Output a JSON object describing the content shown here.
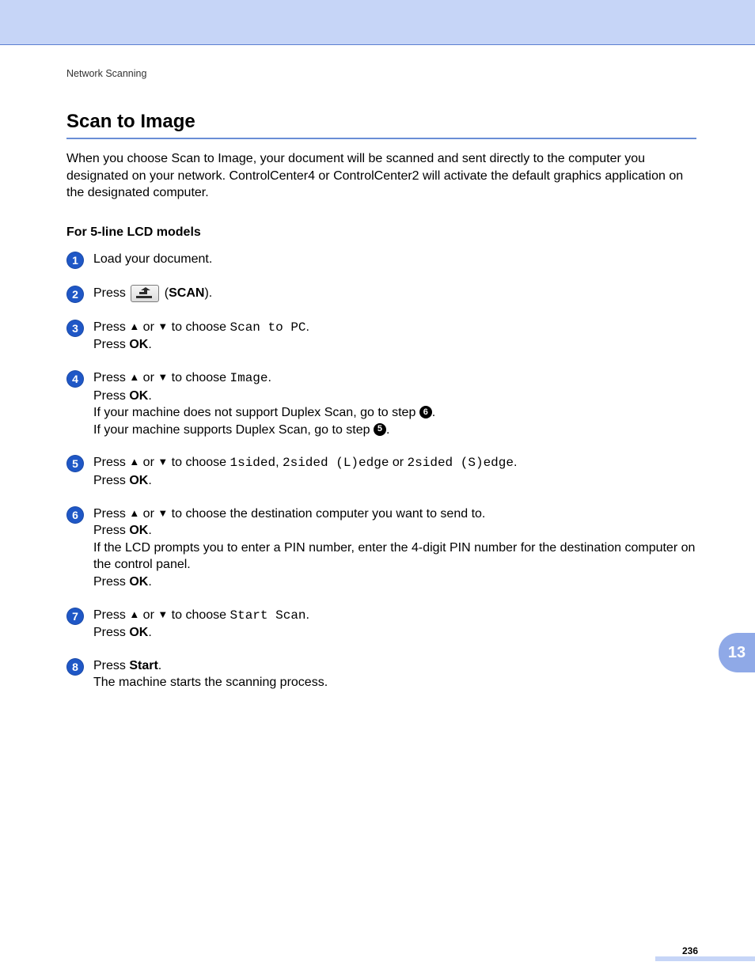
{
  "breadcrumb": "Network Scanning",
  "heading": "Scan to Image",
  "intro": "When you choose Scan to Image, your document will be scanned and sent directly to the computer you designated on your network. ControlCenter4 or ControlCenter2 will activate the default graphics application on the designated computer.",
  "subheading": "For 5-line LCD models",
  "ok_label": "OK",
  "chapter_tab": "13",
  "page_number": "236",
  "steps": {
    "s1": {
      "num": "1",
      "text": "Load your document."
    },
    "s2": {
      "num": "2",
      "press": "Press ",
      "scan_label": "SCAN",
      "close": ")."
    },
    "s3": {
      "num": "3",
      "press": "Press ",
      "or": " or ",
      "choose": " to choose ",
      "option": "Scan to PC",
      "press_ok": "Press "
    },
    "s4": {
      "num": "4",
      "press": "Press ",
      "or": " or ",
      "choose": " to choose ",
      "option": "Image",
      "press_ok": "Press ",
      "duplex_no_a": "If your machine does not support Duplex Scan, go to step ",
      "duplex_no_ref": "6",
      "duplex_yes_a": "If your machine supports Duplex Scan, go to step ",
      "duplex_yes_ref": "5"
    },
    "s5": {
      "num": "5",
      "press": "Press ",
      "or": " or ",
      "choose": " to choose ",
      "opt1": "1sided",
      "sep1": ", ",
      "opt2": "2sided (L)edge",
      "sep2": " or ",
      "opt3": "2sided (S)edge",
      "press_ok": "Press "
    },
    "s6": {
      "num": "6",
      "press": "Press ",
      "or": " or ",
      "choose": " to choose the destination computer you want to send to.",
      "press_ok": "Press ",
      "pin": "If the LCD prompts you to enter a PIN number, enter the 4-digit PIN number for the destination computer on the control panel.",
      "press_ok2": "Press "
    },
    "s7": {
      "num": "7",
      "press": "Press ",
      "or": " or ",
      "choose": " to choose ",
      "option": "Start Scan",
      "press_ok": "Press "
    },
    "s8": {
      "num": "8",
      "press": "Press ",
      "start_label": "Start",
      "after": "The machine starts the scanning process."
    }
  }
}
